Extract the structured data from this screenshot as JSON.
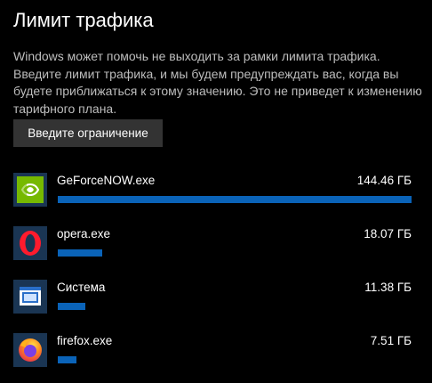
{
  "header": {
    "title": "Лимит трафика",
    "description": "Windows может помочь не выходить за рамки лимита трафика. Введите лимит трафика, и мы будем предупреждать вас, когда вы будете приближаться к этому значению. Это не приведет к изменению тарифного плана."
  },
  "limit_button": {
    "label": "Введите ограничение"
  },
  "apps": [
    {
      "name": "GeForceNOW.exe",
      "usage": "144.46 ГБ",
      "usage_fraction": 1.0,
      "icon": "nvidia-icon"
    },
    {
      "name": "opera.exe",
      "usage": "18.07 ГБ",
      "usage_fraction": 0.125,
      "icon": "opera-icon"
    },
    {
      "name": "Система",
      "usage": "11.38 ГБ",
      "usage_fraction": 0.079,
      "icon": "system-icon"
    },
    {
      "name": "firefox.exe",
      "usage": "7.51 ГБ",
      "usage_fraction": 0.052,
      "icon": "firefox-icon"
    }
  ],
  "colors": {
    "background": "#000000",
    "bar_fill": "#0a63b8",
    "icon_tile": "#1a3553",
    "button_bg": "#333333"
  }
}
